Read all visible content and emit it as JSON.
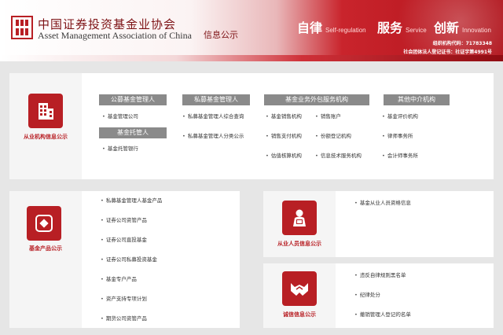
{
  "header": {
    "org_name_cn": "中国证券投资基金业协会",
    "org_name_en": "Asset Management Association of China",
    "site_subtitle": "信息公示",
    "slogans": [
      {
        "cn": "自律",
        "en": "Self-regulation"
      },
      {
        "cn": "服务",
        "en": "Service"
      },
      {
        "cn": "创新",
        "en": "Innovation"
      }
    ],
    "code_line_1": "组织机构代码：71783348",
    "code_line_2": "社会团体法人登记证书：社证字第4991号",
    "brand_color": "#b81f24"
  },
  "institution_panel": {
    "label": "从业机构信息公示",
    "icon": "building-icon",
    "columns": [
      {
        "head": "公募基金管理人",
        "items": [
          "基金管理公司"
        ]
      },
      {
        "head": "基金托管人",
        "items": [
          "基金托管银行"
        ]
      },
      {
        "head": "私募基金管理人",
        "items": [
          "私募基金管理人综合查询",
          "私募基金管理人分类公示"
        ]
      },
      {
        "head": "基金业务外包服务机构",
        "items": [
          "基金销售机构",
          "销售支付机构",
          "估值核算机构",
          "销售账户",
          "份额登记机构",
          "信息技术服务机构"
        ]
      },
      {
        "head": "其他中介机构",
        "items": [
          "基金评价机构",
          "律师事务所",
          "会计师事务所"
        ]
      }
    ]
  },
  "product_panel": {
    "label": "基金产品公示",
    "icon": "product-icon",
    "items": [
      "私募基金管理人基金产品",
      "证券公司资管产品",
      "证券公司直投基金",
      "证券公司私募投资基金",
      "基金专户产品",
      "资产支持专项计划",
      "期货公司资管产品"
    ]
  },
  "personnel_panel": {
    "label": "从业人员信息公示",
    "icon": "person-icon",
    "items": [
      "基金从业人员资格信息"
    ]
  },
  "integrity_panel": {
    "label": "诚信信息公示",
    "icon": "handshake-icon",
    "items": [
      "违反自律规则黑名单",
      "纪律处分",
      "撤销管理人登记的名单"
    ]
  }
}
